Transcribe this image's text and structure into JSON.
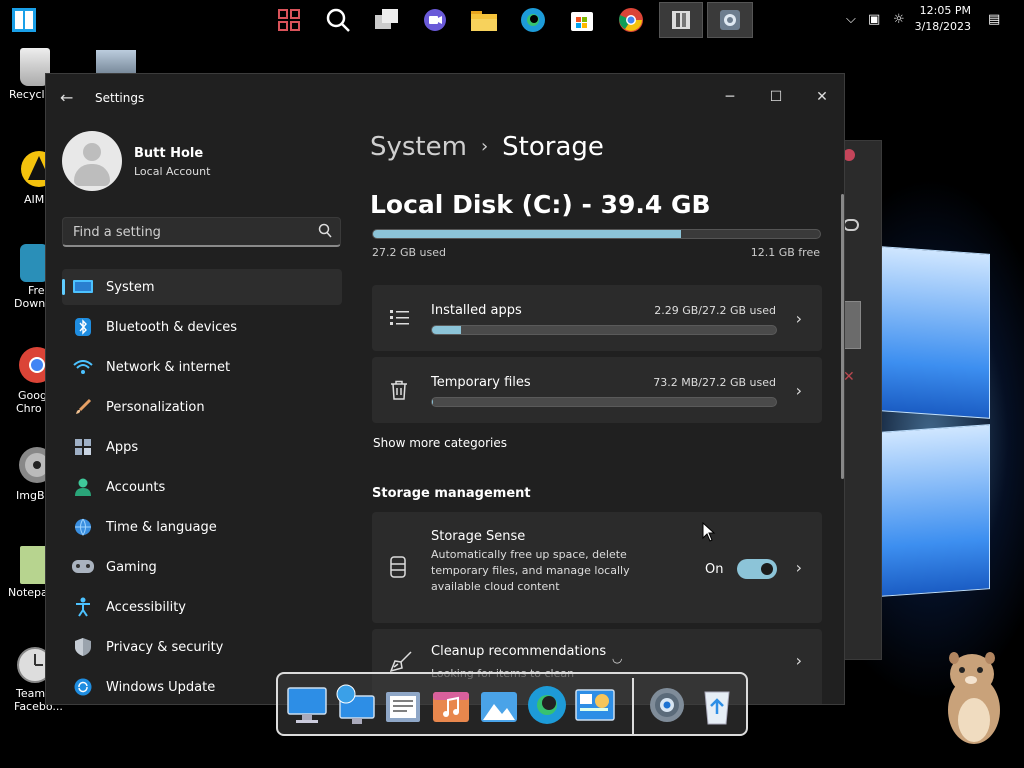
{
  "taskbar": {
    "icons": [
      "start-icon",
      "task-view-icon",
      "search-icon",
      "widgets-icon",
      "chat-icon",
      "file-explorer-icon",
      "edge-icon",
      "store-icon",
      "chrome-icon",
      "panel-icon",
      "settings-icon"
    ],
    "clock_time": "12:05 PM",
    "clock_date": "3/18/2023"
  },
  "desktop": {
    "icons": [
      {
        "label": "Recycle"
      },
      {
        "label": "AIM"
      },
      {
        "label": "Fre"
      },
      {
        "label": "Down"
      },
      {
        "label": "Goog"
      },
      {
        "label": "Chro"
      },
      {
        "label": "ImgB"
      },
      {
        "label": "Notepa"
      },
      {
        "label": "Team"
      },
      {
        "label": "Facebo..."
      }
    ]
  },
  "settings": {
    "title": "Settings",
    "user": {
      "name": "Butt Hole",
      "type": "Local Account"
    },
    "search_placeholder": "Find a setting",
    "nav": [
      {
        "label": "System",
        "icon": "monitor-icon",
        "selected": true
      },
      {
        "label": "Bluetooth & devices",
        "icon": "bluetooth-icon"
      },
      {
        "label": "Network & internet",
        "icon": "wifi-icon"
      },
      {
        "label": "Personalization",
        "icon": "brush-icon"
      },
      {
        "label": "Apps",
        "icon": "apps-icon"
      },
      {
        "label": "Accounts",
        "icon": "person-icon"
      },
      {
        "label": "Time & language",
        "icon": "globe-clock-icon"
      },
      {
        "label": "Gaming",
        "icon": "gamepad-icon"
      },
      {
        "label": "Accessibility",
        "icon": "accessibility-icon"
      },
      {
        "label": "Privacy & security",
        "icon": "shield-icon"
      },
      {
        "label": "Windows Update",
        "icon": "update-icon"
      }
    ],
    "breadcrumb": {
      "parent": "System",
      "separator": "›",
      "current": "Storage"
    },
    "disk": {
      "title": "Local Disk (C:) - 39.4 GB",
      "used_label": "27.2 GB used",
      "free_label": "12.1 GB free",
      "used_fraction": 0.69
    },
    "categories": [
      {
        "title": "Installed apps",
        "meta": "2.29 GB/27.2 GB used",
        "fraction": 0.084,
        "icon": "list-icon"
      },
      {
        "title": "Temporary files",
        "meta": "73.2 MB/27.2 GB used",
        "fraction": 0.003,
        "icon": "trash-icon"
      }
    ],
    "show_more": "Show more categories",
    "management_heading": "Storage management",
    "storage_sense": {
      "title": "Storage Sense",
      "description": "Automatically free up space, delete temporary files, and manage locally available cloud content",
      "toggle_label": "On",
      "toggle_on": true
    },
    "cleanup": {
      "title": "Cleanup recommendations",
      "subtitle": "Looking for items to clean"
    }
  },
  "dock": {
    "items": [
      "monitor-app-icon",
      "network-app-icon",
      "notes-app-icon",
      "music-app-icon",
      "photos-app-icon",
      "edge-app-icon",
      "control-panel-icon",
      "settings-app-icon",
      "recycle-bin-icon"
    ]
  },
  "colors": {
    "accent": "#60cdff",
    "bar_fill": "#8cc4d8",
    "window_bg": "#202020",
    "card_bg": "#2b2b2b"
  }
}
